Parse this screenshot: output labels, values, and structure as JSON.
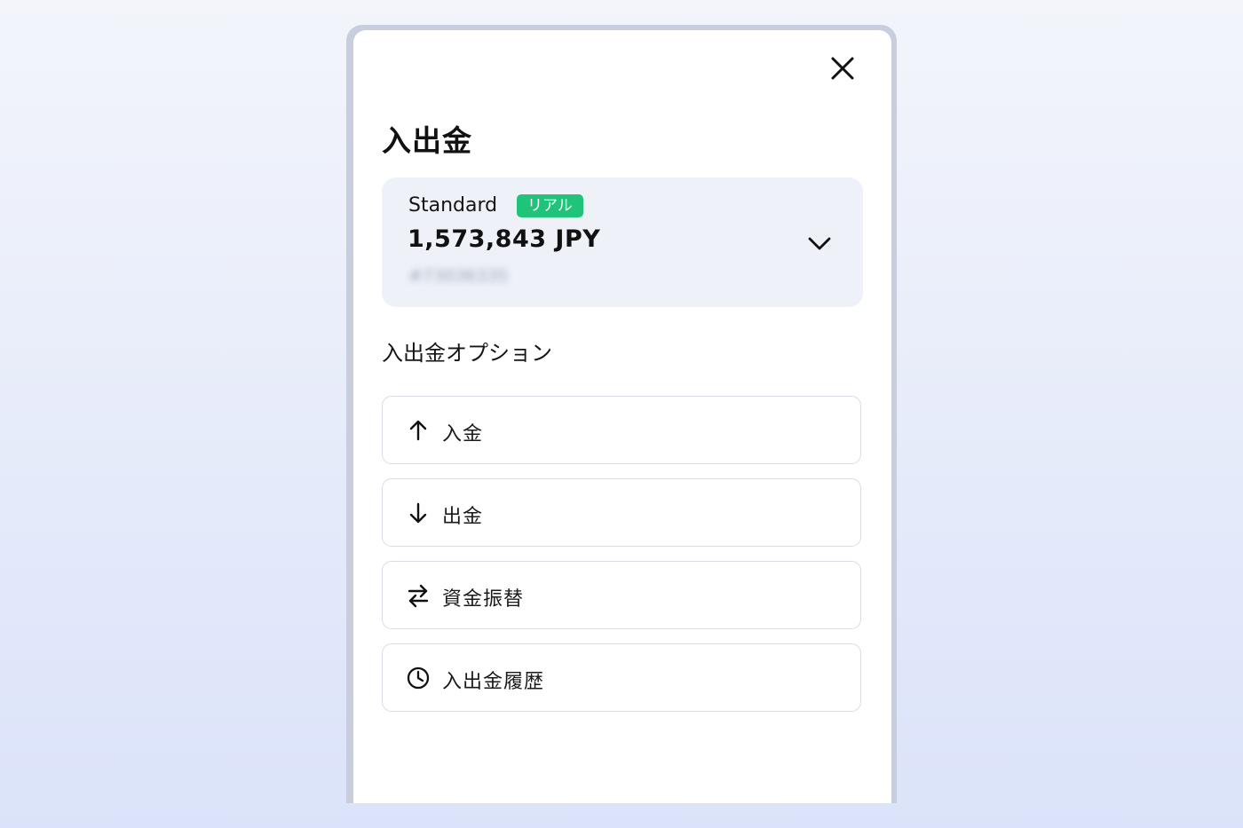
{
  "modal": {
    "title": "入出金",
    "close_icon": "close-icon"
  },
  "account": {
    "type": "Standard",
    "badge": "リアル",
    "badge_color": "#1fc47a",
    "balance": "1,573,843 JPY",
    "number": "#73036335",
    "dropdown_icon": "chevron-down-icon"
  },
  "options": {
    "heading": "入出金オプション",
    "items": [
      {
        "label": "入金",
        "icon": "arrow-up-icon"
      },
      {
        "label": "出金",
        "icon": "arrow-down-icon"
      },
      {
        "label": "資金振替",
        "icon": "transfer-arrows-icon"
      },
      {
        "label": "入出金履歴",
        "icon": "clock-icon"
      }
    ]
  }
}
